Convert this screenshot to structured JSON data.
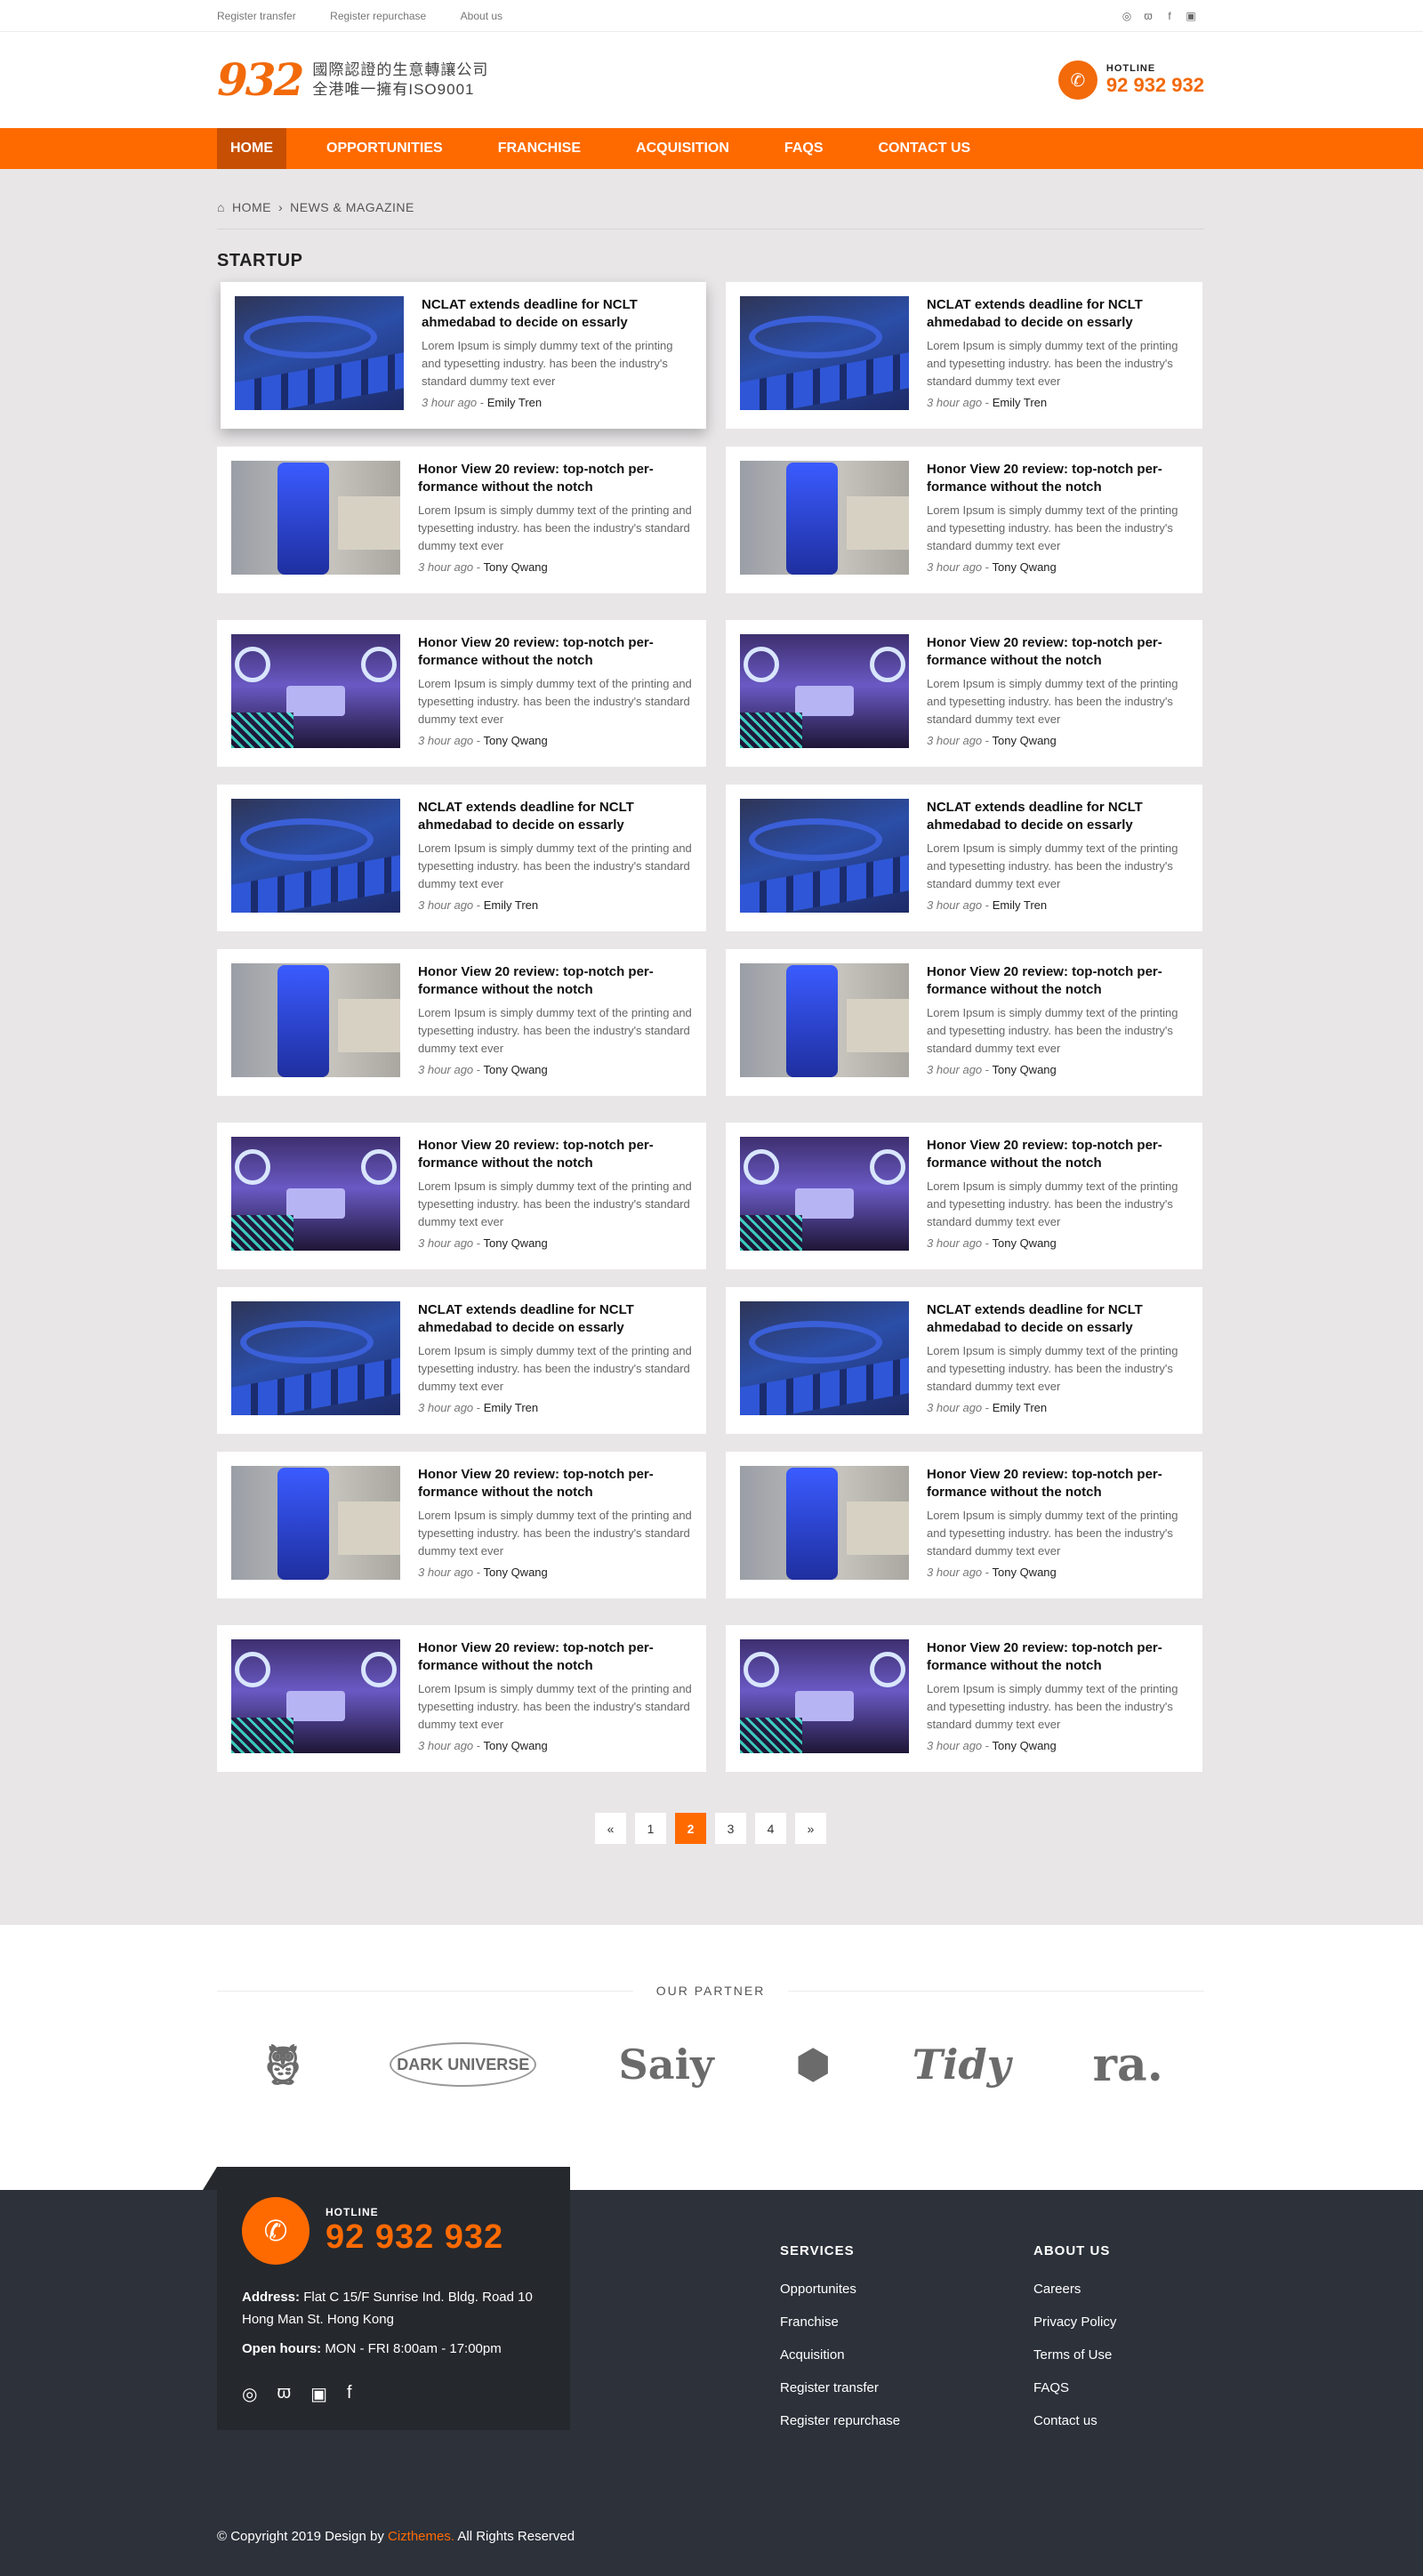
{
  "topbar": {
    "links": [
      "Register transfer",
      "Register repurchase",
      "About us"
    ],
    "social": [
      "whatsapp-icon",
      "weibo-icon",
      "facebook-icon",
      "instagram-icon"
    ]
  },
  "header": {
    "logo_number": "932",
    "logo_line1": "國際認證的生意轉讓公司",
    "logo_line2": "全港唯一擁有ISO9001",
    "hotline_label": "HOTLINE",
    "hotline_number": "92 932 932"
  },
  "nav": [
    "HOME",
    "OPPORTUNITIES",
    "FRANCHISE",
    "ACQUISITION",
    "FAQS",
    "CONTACT US"
  ],
  "breadcrumb": {
    "home": "HOME",
    "separator": "›",
    "current": "NEWS & MAGAZINE"
  },
  "section_title": "STARTUP",
  "articles": [
    {
      "title": "NCLAT extends deadline for NCLT ahmedabad to decide on essarly",
      "excerpt": "Lorem Ipsum is simply dummy text of the printing and typesetting industry. has been the industry's standard dummy text ever",
      "time": "3 hour ago",
      "author": "Emily Tren",
      "image": "car"
    },
    {
      "title": "NCLAT extends deadline for NCLT ahmedabad to decide on essarly",
      "excerpt": "Lorem Ipsum is simply dummy text of the printing and typesetting industry. has been the industry's standard dummy text ever",
      "time": "3 hour ago",
      "author": "Emily Tren",
      "image": "car"
    },
    {
      "title": "Honor View 20 review: top-notch per-formance without the notch",
      "excerpt": "Lorem Ipsum is simply dummy text of the printing and typesetting industry. has been the industry's standard dummy text ever",
      "time": "3 hour ago",
      "author": "Tony Qwang",
      "image": "phone"
    },
    {
      "title": "Honor View 20 review: top-notch per-formance without the notch",
      "excerpt": "Lorem Ipsum is simply dummy text of the printing and typesetting industry. has been the industry's standard dummy text ever",
      "time": "3 hour ago",
      "author": "Tony Qwang",
      "image": "phone"
    },
    {
      "title": "Honor View 20 review: top-notch per-formance without the notch",
      "excerpt": "Lorem Ipsum is simply dummy text of the printing and typesetting industry. has been the industry's standard dummy text ever",
      "time": "3 hour ago",
      "author": "Tony Qwang",
      "image": "robot"
    },
    {
      "title": "Honor View 20 review: top-notch per-formance without the notch",
      "excerpt": "Lorem Ipsum is simply dummy text of the printing and typesetting industry. has been the industry's standard dummy text ever",
      "time": "3 hour ago",
      "author": "Tony Qwang",
      "image": "robot"
    },
    {
      "title": "NCLAT extends deadline for NCLT ahmedabad to decide on essarly",
      "excerpt": "Lorem Ipsum is simply dummy text of the printing and typesetting industry. has been the industry's standard dummy text ever",
      "time": "3 hour ago",
      "author": "Emily Tren",
      "image": "car"
    },
    {
      "title": "NCLAT extends deadline for NCLT ahmedabad to decide on essarly",
      "excerpt": "Lorem Ipsum is simply dummy text of the printing and typesetting industry. has been the industry's standard dummy text ever",
      "time": "3 hour ago",
      "author": "Emily Tren",
      "image": "car"
    },
    {
      "title": "Honor View 20 review: top-notch per-formance without the notch",
      "excerpt": "Lorem Ipsum is simply dummy text of the printing and typesetting industry. has been the industry's standard dummy text ever",
      "time": "3 hour ago",
      "author": "Tony Qwang",
      "image": "phone"
    },
    {
      "title": "Honor View 20 review: top-notch per-formance without the notch",
      "excerpt": "Lorem Ipsum is simply dummy text of the printing and typesetting industry. has been the industry's standard dummy text ever",
      "time": "3 hour ago",
      "author": "Tony Qwang",
      "image": "phone"
    },
    {
      "title": "Honor View 20 review: top-notch per-formance without the notch",
      "excerpt": "Lorem Ipsum is simply dummy text of the printing and typesetting industry. has been the industry's standard dummy text ever",
      "time": "3 hour ago",
      "author": "Tony Qwang",
      "image": "robot"
    },
    {
      "title": "Honor View 20 review: top-notch per-formance without the notch",
      "excerpt": "Lorem Ipsum is simply dummy text of the printing and typesetting industry. has been the industry's standard dummy text ever",
      "time": "3 hour ago",
      "author": "Tony Qwang",
      "image": "robot"
    },
    {
      "title": "NCLAT extends deadline for NCLT ahmedabad to decide on essarly",
      "excerpt": "Lorem Ipsum is simply dummy text of the printing and typesetting industry. has been the industry's standard dummy text ever",
      "time": "3 hour ago",
      "author": "Emily Tren",
      "image": "car"
    },
    {
      "title": "NCLAT extends deadline for NCLT ahmedabad to decide on essarly",
      "excerpt": "Lorem Ipsum is simply dummy text of the printing and typesetting industry. has been the industry's standard dummy text ever",
      "time": "3 hour ago",
      "author": "Emily Tren",
      "image": "car"
    },
    {
      "title": "Honor View 20 review: top-notch per-formance without the notch",
      "excerpt": "Lorem Ipsum is simply dummy text of the printing and typesetting industry. has been the industry's standard dummy text ever",
      "time": "3 hour ago",
      "author": "Tony Qwang",
      "image": "phone"
    },
    {
      "title": "Honor View 20 review: top-notch per-formance without the notch",
      "excerpt": "Lorem Ipsum is simply dummy text of the printing and typesetting industry. has been the industry's standard dummy text ever",
      "time": "3 hour ago",
      "author": "Tony Qwang",
      "image": "phone"
    },
    {
      "title": "Honor View 20 review: top-notch per-formance without the notch",
      "excerpt": "Lorem Ipsum is simply dummy text of the printing and typesetting industry. has been the industry's standard dummy text ever",
      "time": "3 hour ago",
      "author": "Tony Qwang",
      "image": "robot"
    },
    {
      "title": "Honor View 20 review: top-notch per-formance without the notch",
      "excerpt": "Lorem Ipsum is simply dummy text of the printing and typesetting industry. has been the industry's standard dummy text ever",
      "time": "3 hour ago",
      "author": "Tony Qwang",
      "image": "robot"
    }
  ],
  "pagination": {
    "prev": "«",
    "pages": [
      "1",
      "2",
      "3",
      "4"
    ],
    "current": "2",
    "next": "»"
  },
  "partners": {
    "label": "OUR PARTNER",
    "logos": [
      "owl-logo",
      "DARK UNIVERSE",
      "Saiy",
      "lion-logo",
      "Tidy",
      "ra."
    ]
  },
  "footer": {
    "hotline_label": "HOTLINE",
    "hotline_number": "92 932 932",
    "address_label": "Address:",
    "address": "Flat C 15/F Sunrise Ind. Bldg.  Road 10 Hong Man St. Hong Kong",
    "hours_label": "Open hours:",
    "hours": "MON - FRI  8:00am - 17:00pm",
    "social": [
      "whatsapp-icon",
      "weibo-icon",
      "instagram-icon",
      "facebook-icon"
    ],
    "services_title": "SERVICES",
    "services": [
      "Opportunites",
      "Franchise",
      "Acquisition",
      "Register transfer",
      "Register repurchase"
    ],
    "about_title": "ABOUT US",
    "about": [
      "Careers",
      "Privacy Policy",
      "Terms of Use",
      "FAQS",
      "Contact us"
    ],
    "copyright_prefix": "© Copyright 2019 Design by",
    "copyright_brand": "Cizthemes.",
    "copyright_suffix": "All Rights Reserved"
  },
  "colors": {
    "accent": "#ff6a00",
    "nav_active": "#c74f03",
    "footer_bg": "#2c313a",
    "content_bg": "#e8e6e7"
  }
}
